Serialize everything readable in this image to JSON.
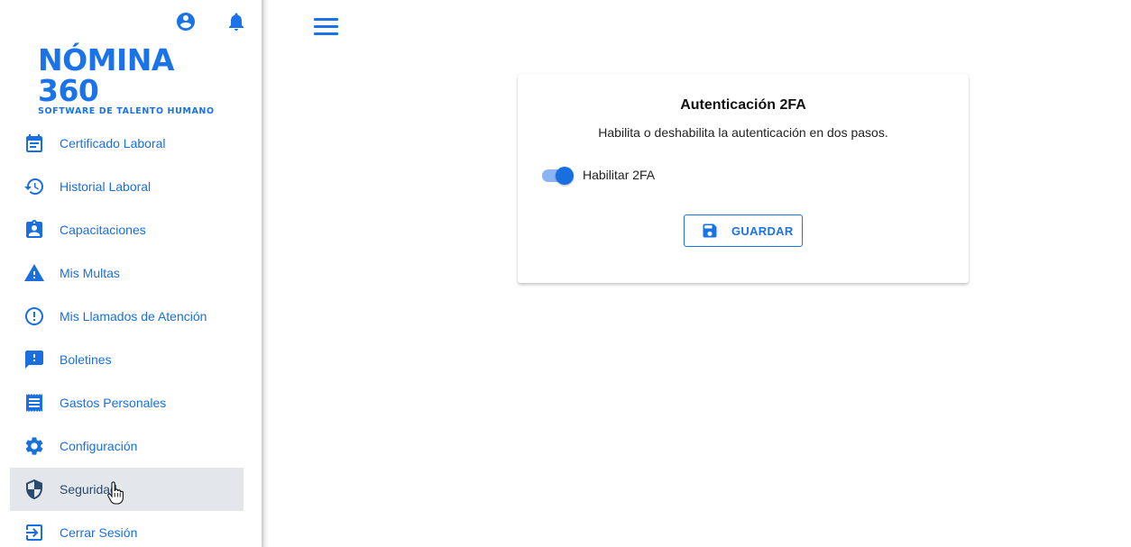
{
  "brand": {
    "name": "NÓMINA 360",
    "tagline": "SOFTWARE DE TALENTO HUMANO",
    "color": "#1a73e8"
  },
  "header_icons": [
    {
      "icon": "account-circle-icon"
    },
    {
      "icon": "bell-icon"
    }
  ],
  "sidebar": {
    "items": [
      {
        "label": "Certificado Laboral",
        "icon": "calendar-icon",
        "active": false
      },
      {
        "label": "Historial Laboral",
        "icon": "history-icon",
        "active": false
      },
      {
        "label": "Capacitaciones",
        "icon": "clipboard-user-icon",
        "active": false
      },
      {
        "label": "Mis Multas",
        "icon": "warning-icon",
        "active": false
      },
      {
        "label": "Mis Llamados de Atención",
        "icon": "alert-circle-icon",
        "active": false
      },
      {
        "label": "Boletines",
        "icon": "feedback-icon",
        "active": false
      },
      {
        "label": "Gastos Personales",
        "icon": "receipt-icon",
        "active": false
      },
      {
        "label": "Configuración",
        "icon": "gear-icon",
        "active": false
      },
      {
        "label": "Seguridad",
        "icon": "shield-icon",
        "active": true
      },
      {
        "label": "Cerrar Sesión",
        "icon": "logout-icon",
        "active": false
      }
    ]
  },
  "card": {
    "title": "Autenticación 2FA",
    "description": "Habilita o deshabilita la autenticación en dos pasos.",
    "toggle_label": "Habilitar 2FA",
    "toggle_on": true,
    "save_label": "GUARDAR"
  },
  "colors": {
    "accent": "#1a73e8",
    "active_bg": "#e3e6ea",
    "active_text": "#2a4a6e"
  }
}
